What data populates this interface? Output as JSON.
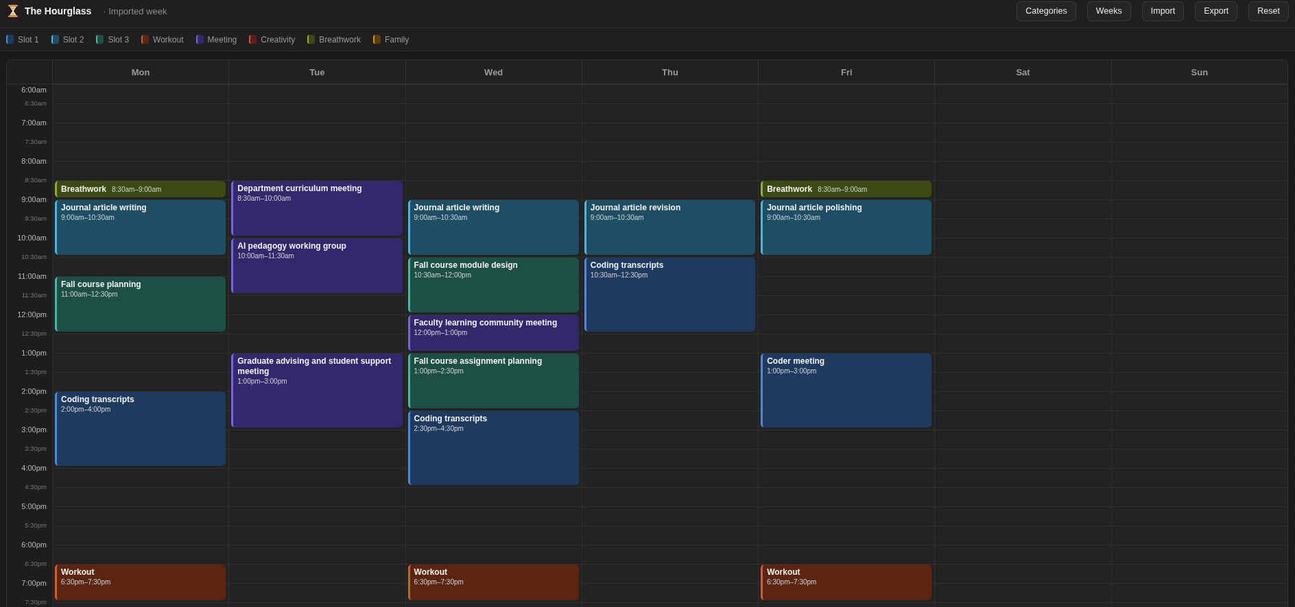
{
  "header": {
    "title": "The Hourglass",
    "subtitle": "· Imported week",
    "buttons": [
      "Categories",
      "Weeks",
      "Import",
      "Export",
      "Reset"
    ]
  },
  "legend": [
    {
      "label": "Slot 1",
      "color": "#1f3a5f"
    },
    {
      "label": "Slot 2",
      "color": "#1d4e63"
    },
    {
      "label": "Slot 3",
      "color": "#1d4f45"
    },
    {
      "label": "Workout",
      "color": "#5c2512"
    },
    {
      "label": "Meeting",
      "color": "#32286b"
    },
    {
      "label": "Creativity",
      "color": "#5e1f1c"
    },
    {
      "label": "Breathwork",
      "color": "#3c4a12"
    },
    {
      "label": "Family",
      "color": "#5e3e0e"
    }
  ],
  "calendar": {
    "times": [
      {
        "label": "6:00am",
        "kind": "hour"
      },
      {
        "label": "6:30am",
        "kind": "half"
      },
      {
        "label": "7:00am",
        "kind": "hour"
      },
      {
        "label": "7:30am",
        "kind": "half"
      },
      {
        "label": "8:00am",
        "kind": "hour"
      },
      {
        "label": "8:30am",
        "kind": "half"
      },
      {
        "label": "9:00am",
        "kind": "hour"
      },
      {
        "label": "9:30am",
        "kind": "half"
      },
      {
        "label": "10:00am",
        "kind": "hour"
      },
      {
        "label": "10:30am",
        "kind": "half"
      },
      {
        "label": "11:00am",
        "kind": "hour"
      },
      {
        "label": "11:30am",
        "kind": "half"
      },
      {
        "label": "12:00pm",
        "kind": "hour"
      },
      {
        "label": "12:30pm",
        "kind": "half"
      },
      {
        "label": "1:00pm",
        "kind": "hour"
      },
      {
        "label": "1:30pm",
        "kind": "half"
      },
      {
        "label": "2:00pm",
        "kind": "hour"
      },
      {
        "label": "2:30pm",
        "kind": "half"
      },
      {
        "label": "3:00pm",
        "kind": "hour"
      },
      {
        "label": "3:30pm",
        "kind": "half"
      },
      {
        "label": "4:00pm",
        "kind": "hour"
      },
      {
        "label": "4:30pm",
        "kind": "half"
      },
      {
        "label": "5:00pm",
        "kind": "hour"
      },
      {
        "label": "5:30pm",
        "kind": "half"
      },
      {
        "label": "6:00pm",
        "kind": "hour"
      },
      {
        "label": "6:30pm",
        "kind": "half"
      },
      {
        "label": "7:00pm",
        "kind": "hour"
      },
      {
        "label": "7:30pm",
        "kind": "half"
      }
    ],
    "days": [
      {
        "label": "Mon",
        "events": [
          {
            "title": "Breathwork",
            "time": "8:30am–9:00am",
            "color": "#3c4a12"
          },
          {
            "title": "Journal article writing",
            "time": "9:00am–10:30am",
            "color": "#1d4e63"
          },
          {
            "title": "Fall course planning",
            "time": "11:00am–12:30pm",
            "color": "#1d4f45"
          },
          {
            "title": "Coding transcripts",
            "time": "2:00pm–4:00pm",
            "color": "#1f3a5f"
          },
          {
            "title": "Workout",
            "time": "6:30pm–7:30pm",
            "color": "#5c2512"
          }
        ]
      },
      {
        "label": "Tue",
        "events": [
          {
            "title": "Department curriculum meeting",
            "time": "8:30am–10:00am",
            "color": "#32286b"
          },
          {
            "title": "AI pedagogy working group",
            "time": "10:00am–11:30am",
            "color": "#32286b"
          },
          {
            "title": "Graduate advising and student support meeting",
            "time": "1:00pm–3:00pm",
            "color": "#32286b"
          }
        ]
      },
      {
        "label": "Wed",
        "events": [
          {
            "title": "Journal article writing",
            "time": "9:00am–10:30am",
            "color": "#1d4e63"
          },
          {
            "title": "Fall course module design",
            "time": "10:30am–12:00pm",
            "color": "#1d4f45"
          },
          {
            "title": "Faculty learning community meeting",
            "time": "12:00pm–1:00pm",
            "color": "#32286b"
          },
          {
            "title": "Fall course assignment planning",
            "time": "1:00pm–2:30pm",
            "color": "#1d4f45"
          },
          {
            "title": "Coding transcripts",
            "time": "2:30pm–4:30pm",
            "color": "#1f3a5f"
          },
          {
            "title": "Workout",
            "time": "6:30pm–7:30pm",
            "color": "#5c2512"
          }
        ]
      },
      {
        "label": "Thu",
        "events": [
          {
            "title": "Journal article revision",
            "time": "9:00am–10:30am",
            "color": "#1d4e63"
          },
          {
            "title": "Coding transcripts",
            "time": "10:30am–12:30pm",
            "color": "#1f3a5f"
          }
        ]
      },
      {
        "label": "Fri",
        "events": [
          {
            "title": "Breathwork",
            "time": "8:30am–9:00am",
            "color": "#3c4a12"
          },
          {
            "title": "Journal article polishing",
            "time": "9:00am–10:30am",
            "color": "#1d4e63"
          },
          {
            "title": "Coder meeting",
            "time": "1:00pm–3:00pm",
            "color": "#1f3a5f"
          },
          {
            "title": "Workout",
            "time": "6:30pm–7:30pm",
            "color": "#5c2512"
          }
        ]
      },
      {
        "label": "Sat"
      },
      {
        "label": "Sun"
      }
    ]
  }
}
